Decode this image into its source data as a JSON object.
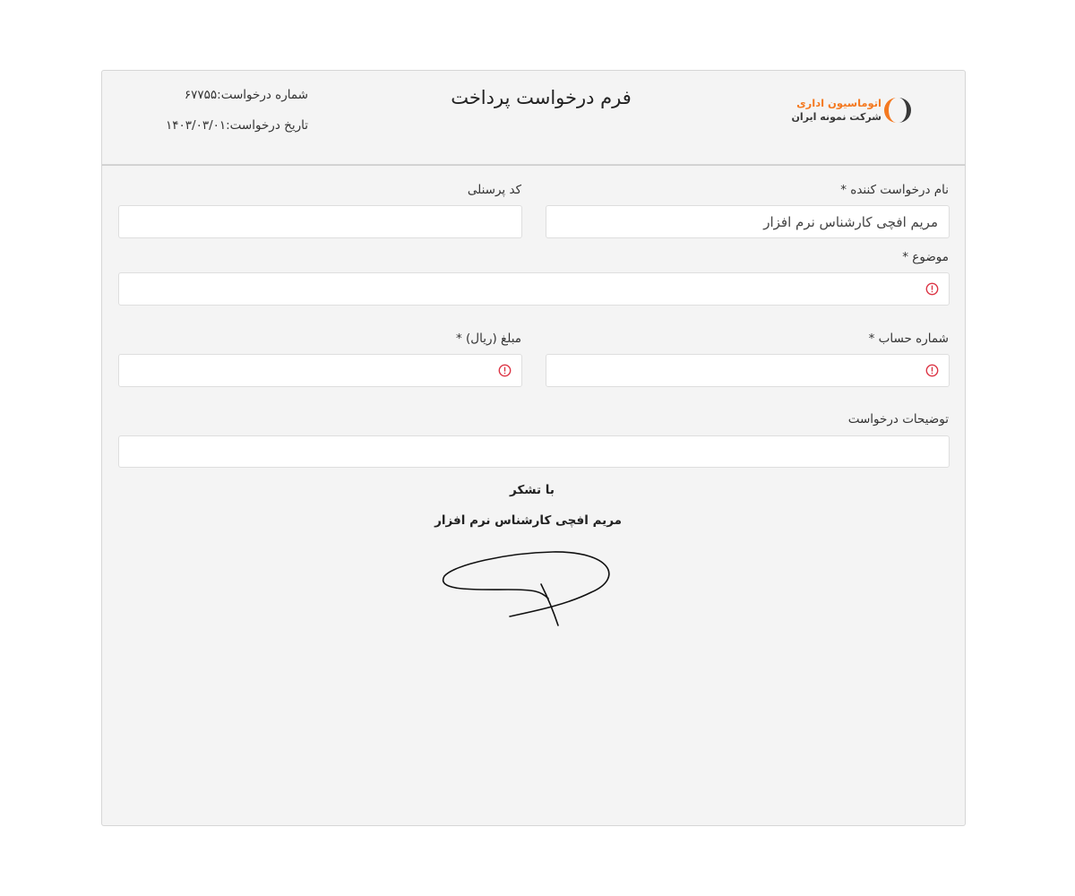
{
  "header": {
    "logo": {
      "line1": "اتوماسیون اداری",
      "line2": "شرکت نمونه ایران",
      "accent_color": "#f47920",
      "mark_icon": "company-logo-icon"
    },
    "title": "فرم درخواست پرداخت",
    "request_number": "شماره درخواست:۶۷۷۵۵",
    "request_date": "تاریخ درخواست:۱۴۰۳/۰۳/۰۱"
  },
  "form": {
    "requester_name": {
      "label": "نام درخواست کننده *",
      "value": "مریم افچی کارشناس نرم افزار"
    },
    "personnel_code": {
      "label": "کد پرسنلی",
      "value": ""
    },
    "subject": {
      "label": "موضوع *",
      "value": "",
      "invalid": true
    },
    "account_number": {
      "label": "شماره حساب *",
      "value": "",
      "invalid": true
    },
    "amount": {
      "label": "مبلغ (ریال) *",
      "value": "",
      "invalid": true
    },
    "description": {
      "label": "توضیحات درخواست",
      "value": ""
    }
  },
  "footer": {
    "thanks": "با تشکر",
    "signer": "مریم افچی کارشناس نرم افزار",
    "signature_icon": "signature-icon"
  },
  "colors": {
    "panel_bg": "#f4f4f4",
    "error": "#dc3545",
    "logo_orange": "#f47920"
  }
}
